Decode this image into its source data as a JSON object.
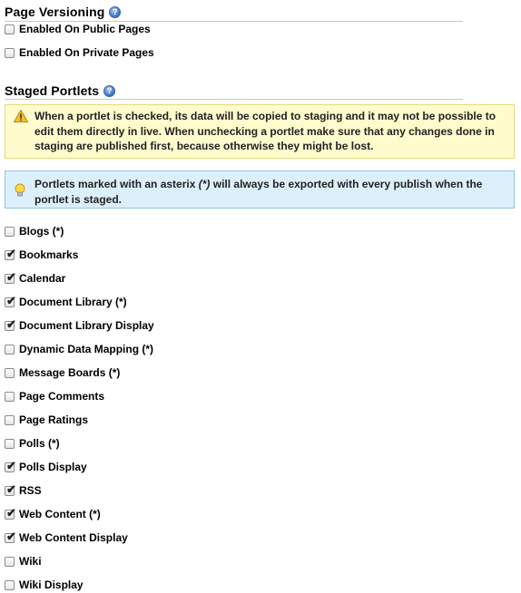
{
  "page_versioning": {
    "title": "Page Versioning",
    "options": [
      {
        "label": "Enabled On Public Pages",
        "checked": false
      },
      {
        "label": "Enabled On Private Pages",
        "checked": false
      }
    ]
  },
  "staged_portlets": {
    "title": "Staged Portlets",
    "warning": "When a portlet is checked, its data will be copied to staging and it may not be possible to edit them directly in live. When unchecking a portlet make sure that any changes done in staging are published first, because otherwise they might be lost.",
    "info_before": "Portlets marked with an asterix ",
    "info_em": "(*)",
    "info_after": " will always be exported with every publish when the portlet is staged.",
    "portlets": [
      {
        "label": "Blogs (*)",
        "checked": false
      },
      {
        "label": "Bookmarks",
        "checked": true
      },
      {
        "label": "Calendar",
        "checked": true
      },
      {
        "label": "Document Library (*)",
        "checked": true
      },
      {
        "label": "Document Library Display",
        "checked": true
      },
      {
        "label": "Dynamic Data Mapping (*)",
        "checked": false
      },
      {
        "label": "Message Boards (*)",
        "checked": false
      },
      {
        "label": "Page Comments",
        "checked": false
      },
      {
        "label": "Page Ratings",
        "checked": false
      },
      {
        "label": "Polls (*)",
        "checked": false
      },
      {
        "label": "Polls Display",
        "checked": true
      },
      {
        "label": "RSS",
        "checked": true
      },
      {
        "label": "Web Content (*)",
        "checked": true
      },
      {
        "label": "Web Content Display",
        "checked": true
      },
      {
        "label": "Wiki",
        "checked": false
      },
      {
        "label": "Wiki Display",
        "checked": false
      }
    ]
  },
  "icons": {
    "help": "help-icon",
    "warning": "warning-icon",
    "info": "lightbulb-icon",
    "check": "checkmark-icon"
  },
  "colors": {
    "warning_bg": "#fffbcc",
    "info_bg": "#dcf0fb",
    "help_blue": "#3a6fc1"
  }
}
